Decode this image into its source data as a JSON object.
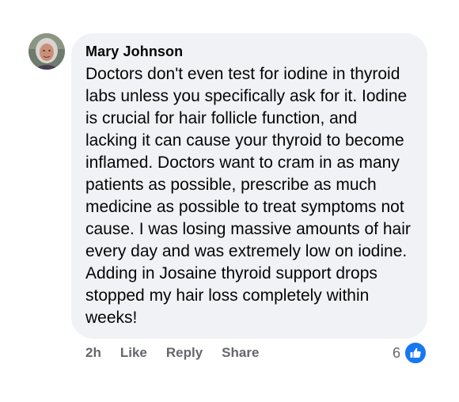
{
  "comment": {
    "author": "Mary Johnson",
    "lines": [
      "Doctors don't even test for iodine in thyroid",
      "labs unless you specifically ask for it. Iodine",
      "is crucial for hair follicle function, and",
      "lacking it can cause your thyroid to become",
      "inflamed. Doctors want to cram in as many",
      "patients as possible, prescribe as much",
      "medicine as possible to treat symptoms not",
      "cause. I was losing massive amounts of hair",
      "every day and was extremely low on iodine.",
      "Adding in Josaine thyroid support drops",
      "stopped my hair loss completely within",
      "weeks!"
    ]
  },
  "actions": {
    "time": "2h",
    "like_label": "Like",
    "reply_label": "Reply",
    "share_label": "Share"
  },
  "reactions": {
    "count": "6",
    "icon": "thumbs-up-icon",
    "badge_color": "#1877f2"
  }
}
